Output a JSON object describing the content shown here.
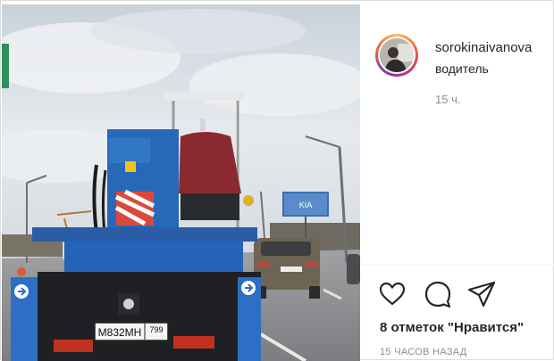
{
  "post": {
    "username": "sorokinaivanova",
    "subtitle": "водитель",
    "time_ago": "15 ч.",
    "likes": "8 отметок \"Нравится\"",
    "date": "15 ЧАСОВ НАЗАД"
  },
  "photo": {
    "license_plate": "М832МН",
    "plate_region": "799",
    "billboard_text": "KIA"
  },
  "icons": {
    "like": "heart-icon",
    "comment": "comment-icon",
    "share": "share-icon"
  },
  "colors": {
    "username": "#262626",
    "muted": "#8e8e8e",
    "truck_blue": "#2868b8",
    "sky": "#dfe5ea",
    "road": "#8d8e90"
  }
}
